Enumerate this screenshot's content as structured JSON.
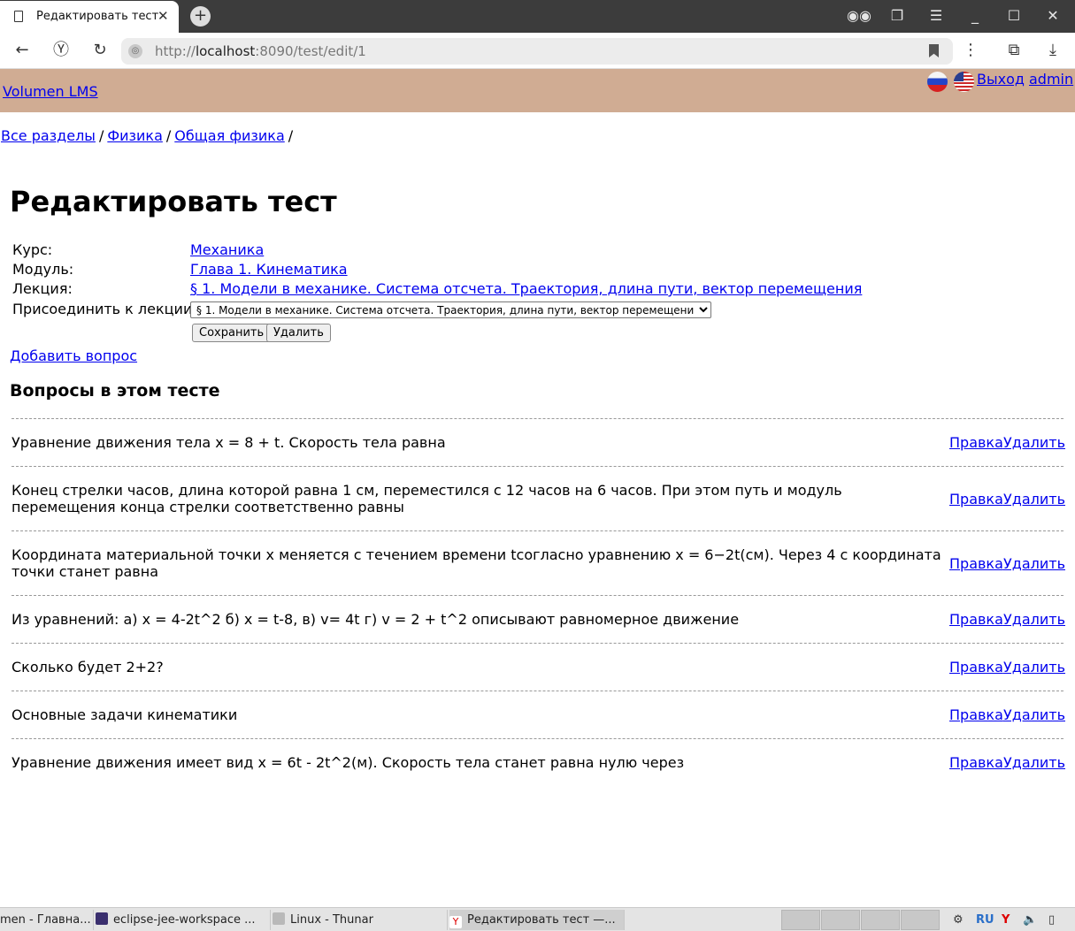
{
  "browser": {
    "tab_title": "Редактировать тест",
    "url_scheme": "http://",
    "url_host": "localhost",
    "url_rest": ":8090/test/edit/1"
  },
  "header": {
    "brand": "Volumen LMS",
    "logout": "Выход",
    "user": "admin"
  },
  "breadcrumb": [
    "Все разделы",
    "Физика",
    "Общая физика"
  ],
  "page_title": "Редактировать тест",
  "meta": {
    "course_label": "Курс:",
    "course_value": "Механика",
    "module_label": "Модуль:",
    "module_value": "Глава 1. Кинематика",
    "lecture_label": "Лекция:",
    "lecture_value": "§ 1. Модели в механике. Система отсчета. Траектория, длина пути, вектор перемещения",
    "attach_label": "Присоединить к лекции",
    "attach_selected": "§ 1. Модели в механике. Система отсчета. Траектория, длина пути, вектор перемещения",
    "save_label": "Сохранить",
    "delete_label": "Удалить"
  },
  "add_question": "Добавить вопрос",
  "section_title": "Вопросы в этом тесте",
  "question_actions": {
    "edit": "Правка",
    "delete": "Удалить"
  },
  "questions": [
    "Уравнение движения тела x = 8 + t. Скорость тела равна",
    "Конец стрелки часов, длина которой равна 1 см, переместился с 12 часов на 6 часов. При этом путь и модуль перемещения конца стрелки соответственно равны",
    "Координата материальной точки x меняется с течением времени tсогласно уравнению x = 6−2t(см). Через 4 с координата точки станет равна",
    "Из уравнений: а) x = 4-2t^2 б) x = t-8, в) v= 4t г) v = 2 + t^2 описывают равномерное движение",
    "Сколько будет 2+2?",
    "Основные задачи кинематики",
    "Уравнение движения имеет вид x = 6t - 2t^2(м). Скорость тела станет равна нулю через"
  ],
  "taskbar": {
    "items": [
      "men - Главна...",
      "eclipse-jee-workspace ...",
      "Linux - Thunar",
      "Редактировать тест —..."
    ],
    "lang": "RU"
  },
  "colors": {
    "header_bg": "#d0ac93",
    "link": "#0000ee"
  }
}
